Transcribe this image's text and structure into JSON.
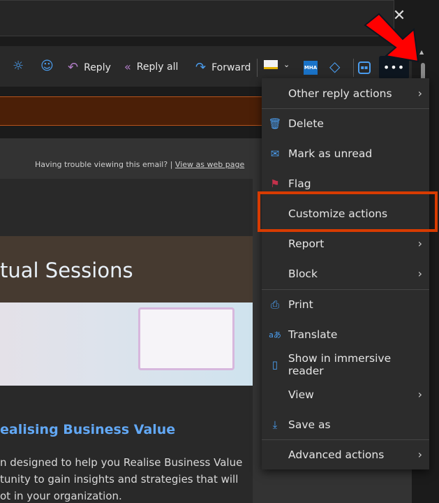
{
  "window": {
    "close_icon": "close-icon"
  },
  "toolbar": {
    "reply": "Reply",
    "reply_all": "Reply all",
    "forward": "Forward",
    "mha": "MHA",
    "more": "•••",
    "colors": {
      "accent": "#4b9ef0",
      "reply_icon": "#b07cc6"
    }
  },
  "email": {
    "trouble_text": "Having trouble viewing this email? |",
    "web_link": "View as web page",
    "hero_title": "tual Sessions",
    "subheading": "ealising Business Value",
    "body_lines": [
      "n designed to help you Realise Business Value",
      "tunity to gain insights and strategies that will",
      "ot in your organization."
    ]
  },
  "menu": {
    "items": [
      {
        "label": "Other reply actions",
        "icon": "",
        "submenu": true
      },
      {
        "label": "Delete",
        "icon": "trash-icon",
        "submenu": false
      },
      {
        "label": "Mark as unread",
        "icon": "envelope-icon",
        "submenu": false
      },
      {
        "label": "Flag",
        "icon": "flag-icon",
        "submenu": false
      },
      {
        "label": "Customize actions",
        "icon": "",
        "submenu": false,
        "highlighted": true
      },
      {
        "label": "Report",
        "icon": "",
        "submenu": true
      },
      {
        "label": "Block",
        "icon": "",
        "submenu": true
      },
      {
        "label": "Print",
        "icon": "printer-icon",
        "submenu": false
      },
      {
        "label": "Translate",
        "icon": "translate-icon",
        "submenu": false
      },
      {
        "label": "Show in immersive reader",
        "icon": "immersive-reader-icon",
        "submenu": false
      },
      {
        "label": "View",
        "icon": "",
        "submenu": true
      },
      {
        "label": "Save as",
        "icon": "download-icon",
        "submenu": false
      },
      {
        "label": "Advanced actions",
        "icon": "",
        "submenu": true
      }
    ]
  },
  "annotation": {
    "highlight_color": "#d83b01",
    "arrow_color": "#ff0000"
  }
}
